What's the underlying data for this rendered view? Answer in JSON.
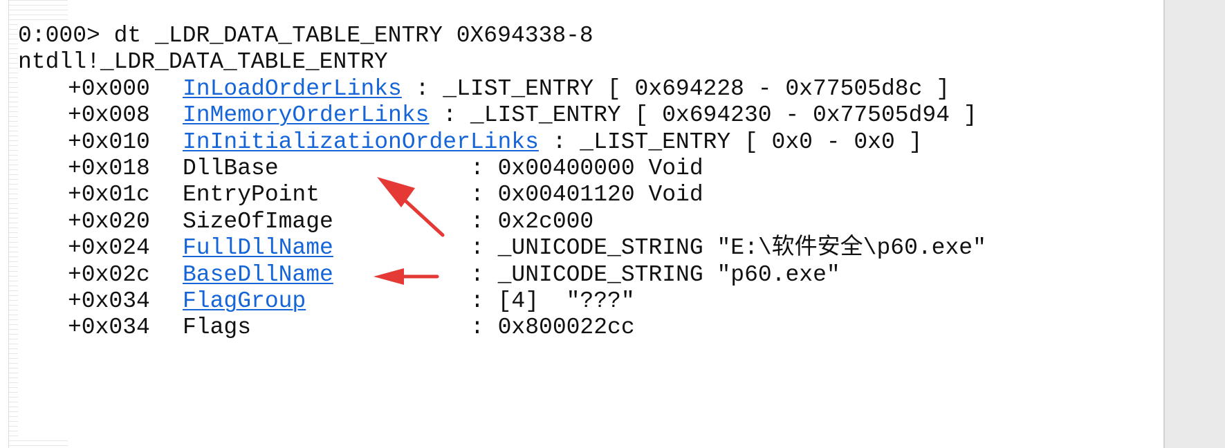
{
  "console": {
    "command_line": "0:000> dt _LDR_DATA_TABLE_ENTRY 0X694338-8",
    "type_header": "ntdll!_LDR_DATA_TABLE_ENTRY",
    "fields": [
      {
        "offset": "+0x000",
        "name": "InLoadOrderLinks",
        "value": ": _LIST_ENTRY [ 0x694228 - 0x77505d8c ]"
      },
      {
        "offset": "+0x008",
        "name": "InMemoryOrderLinks",
        "value": ": _LIST_ENTRY [ 0x694230 - 0x77505d94 ]"
      },
      {
        "offset": "+0x010",
        "name": "InInitializationOrderLinks",
        "value": ": _LIST_ENTRY [ 0x0 - 0x0 ]"
      },
      {
        "offset": "+0x018",
        "name": "DllBase",
        "value": ": 0x00400000 Void"
      },
      {
        "offset": "+0x01c",
        "name": "EntryPoint",
        "value": ": 0x00401120 Void"
      },
      {
        "offset": "+0x020",
        "name": "SizeOfImage",
        "value": ": 0x2c000"
      },
      {
        "offset": "+0x024",
        "name": "FullDllName",
        "value": ": _UNICODE_STRING \"E:\\软件安全\\p60.exe\""
      },
      {
        "offset": "+0x02c",
        "name": "BaseDllName",
        "value": ": _UNICODE_STRING \"p60.exe\""
      },
      {
        "offset": "+0x034",
        "name": "FlagGroup",
        "value": ": [4]  \"???\""
      },
      {
        "offset": "+0x034",
        "name": "Flags",
        "value": ": 0x800022cc"
      }
    ]
  },
  "annotations": {
    "arrow_color": "#e53935",
    "link_color": "#1565d8"
  }
}
